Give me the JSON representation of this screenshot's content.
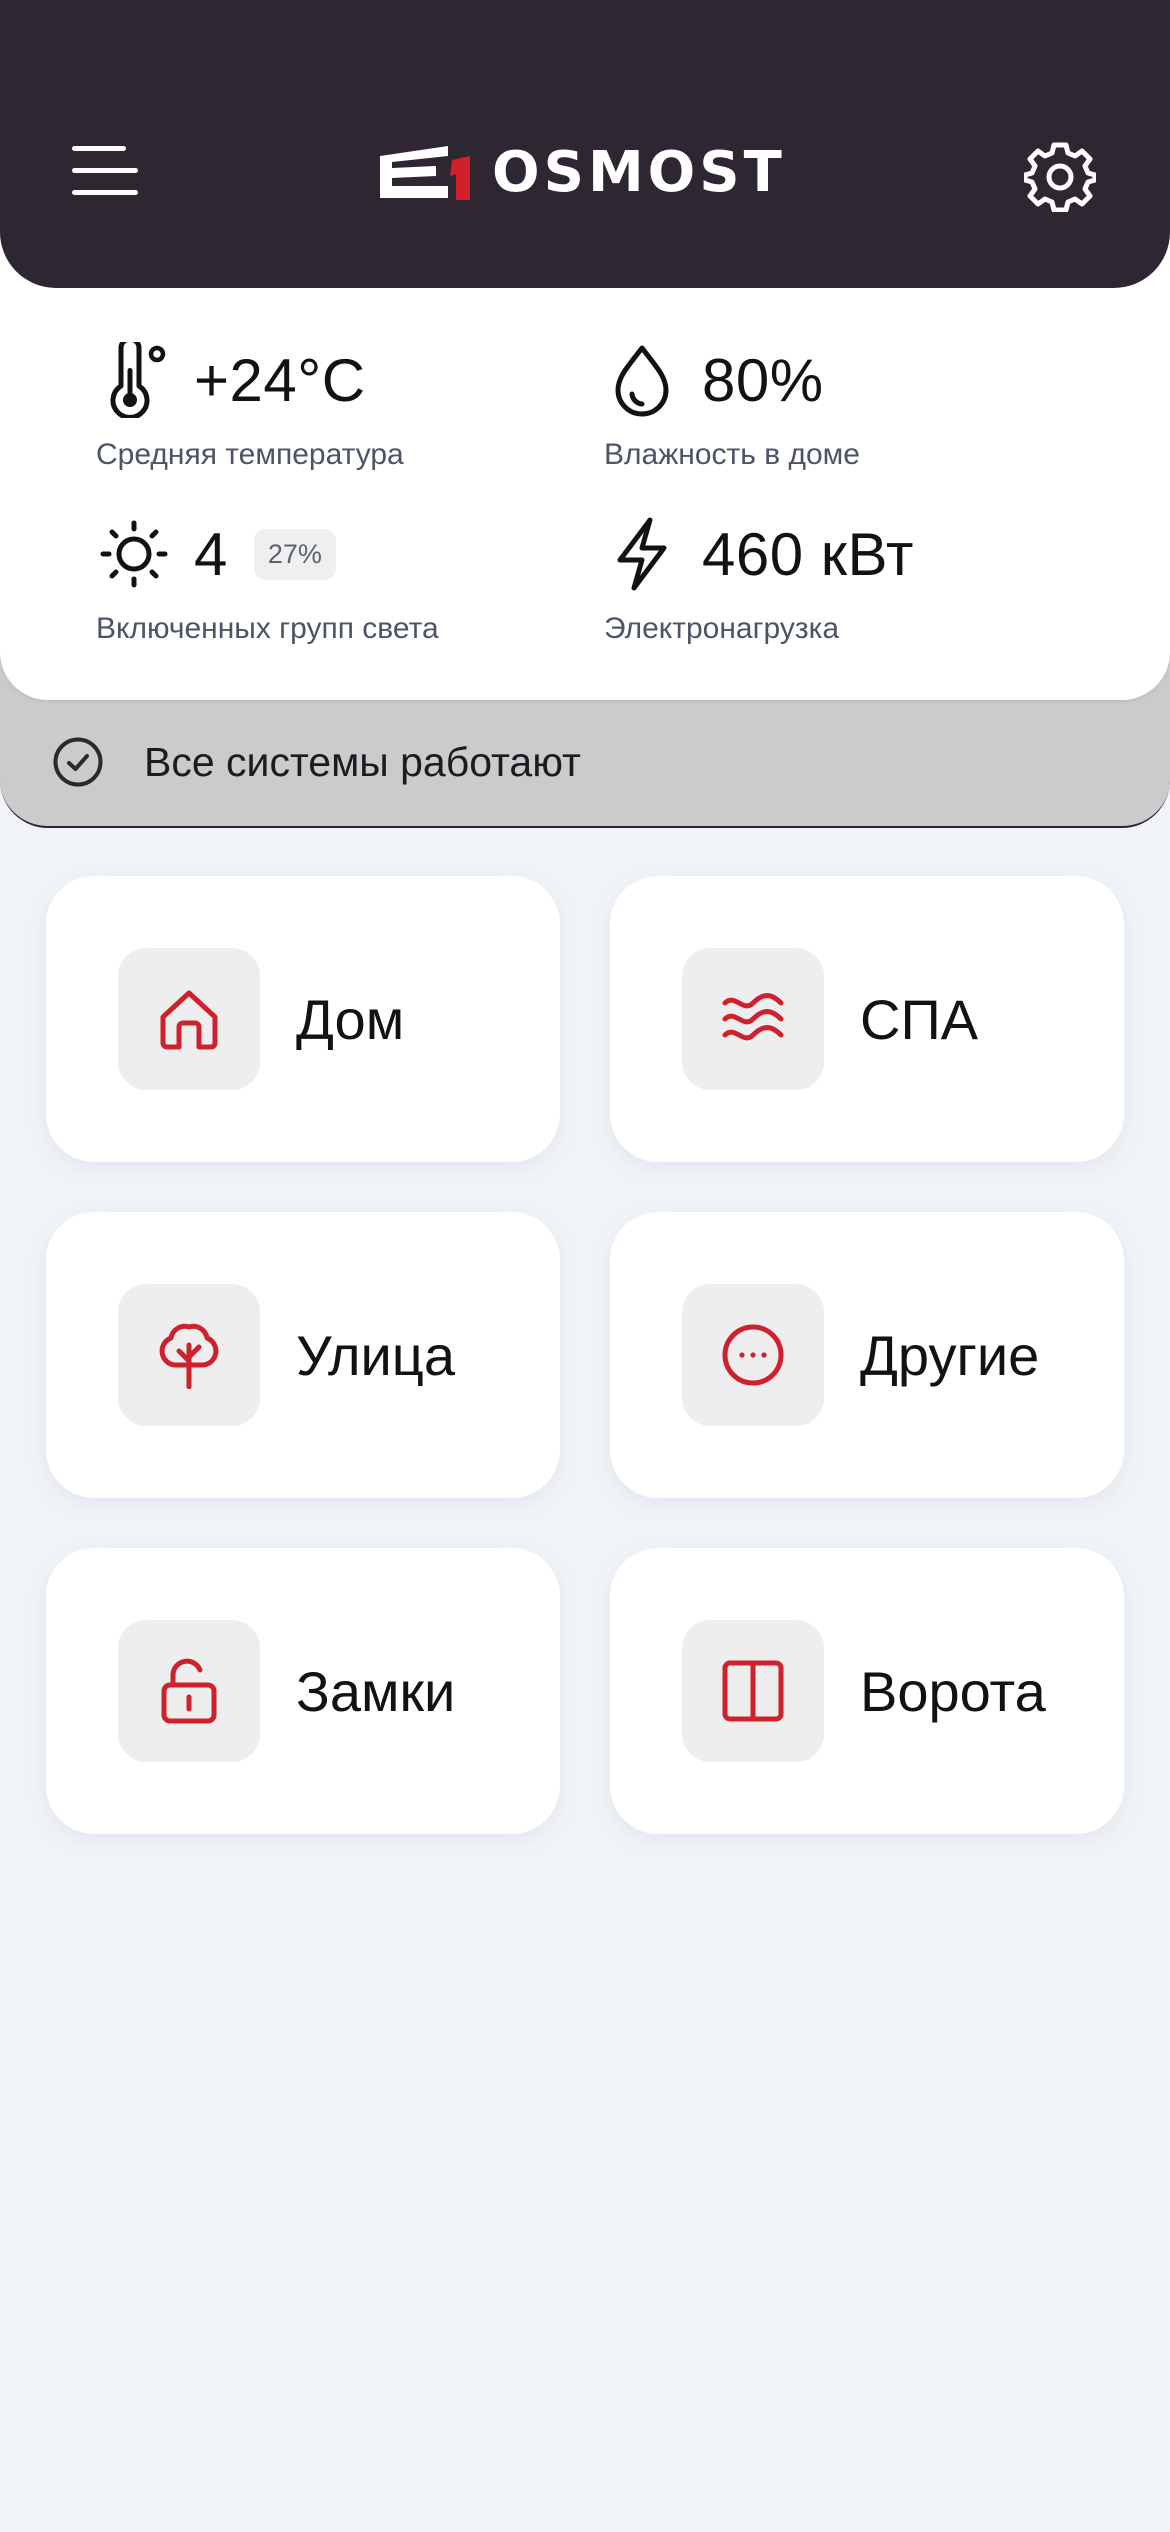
{
  "header": {
    "brand": "OSMOST",
    "menu_icon": "hamburger-menu-icon",
    "settings_icon": "gear-icon",
    "background": "#2e2731"
  },
  "stats": [
    {
      "icon": "thermometer-icon",
      "value": "+24°C",
      "label": "Средняя температура"
    },
    {
      "icon": "droplet-icon",
      "value": "80%",
      "label": "Влажность в доме"
    },
    {
      "icon": "sun-icon",
      "value": "4",
      "badge": "27%",
      "label": "Включенных групп света"
    },
    {
      "icon": "lightning-icon",
      "value": "460 кВт",
      "label": "Электронагрузка"
    }
  ],
  "status": {
    "icon": "check-circle-icon",
    "text": "Все системы работают"
  },
  "categories": [
    {
      "icon": "home-icon",
      "label": "Дом"
    },
    {
      "icon": "waves-icon",
      "label": "СПА"
    },
    {
      "icon": "tree-icon",
      "label": "Улица"
    },
    {
      "icon": "more-circle-icon",
      "label": "Другие"
    },
    {
      "icon": "unlock-icon",
      "label": "Замки"
    },
    {
      "icon": "gate-icon",
      "label": "Ворота"
    }
  ],
  "colors": {
    "accent": "#d0202c",
    "background": "#f0f3f7",
    "status_band": "#cbcbcb",
    "tile_icon_bg": "#eeeeee"
  }
}
